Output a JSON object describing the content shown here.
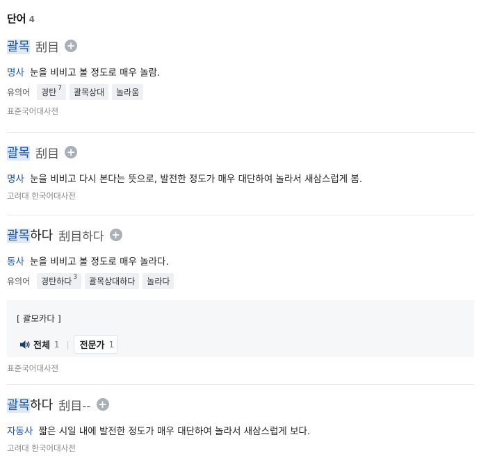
{
  "section": {
    "title": "단어",
    "count": "4"
  },
  "entries": [
    {
      "word_highlight": "괄목",
      "word_rest": "",
      "hanja": "刮目",
      "plus": "+",
      "pos": "명사",
      "definition": "눈을 비비고 볼 정도로 매우 놀람.",
      "synonym_label": "유의어",
      "synonyms": [
        {
          "text": "경탄",
          "sup": "7"
        },
        {
          "text": "괄목상대",
          "sup": ""
        },
        {
          "text": "놀라움",
          "sup": ""
        }
      ],
      "source": "표준국어대사전"
    },
    {
      "word_highlight": "괄목",
      "word_rest": "",
      "hanja": "刮目",
      "plus": "+",
      "pos": "명사",
      "definition": "눈을 비비고 다시 본다는 뜻으로, 발전한 정도가 매우 대단하여 놀라서 새삼스럽게 봄.",
      "source": "고려대 한국어대사전"
    },
    {
      "word_highlight": "괄목",
      "word_rest": "하다",
      "hanja": "刮目하다",
      "plus": "+",
      "pos": "동사",
      "definition": "눈을 비비고 볼 정도로 매우 놀라다.",
      "synonym_label": "유의어",
      "synonyms": [
        {
          "text": "경탄하다",
          "sup": "3"
        },
        {
          "text": "괄목상대하다",
          "sup": ""
        },
        {
          "text": "놀라다",
          "sup": ""
        }
      ],
      "pronunciation": "[ 괄모카다 ]",
      "audio_tabs": [
        {
          "label": "전체",
          "count": "1",
          "icon": "speaker-icon"
        },
        {
          "label": "전문가",
          "count": "1"
        }
      ],
      "source": "표준국어대사전"
    },
    {
      "word_highlight": "괄목",
      "word_rest": "하다",
      "hanja": "刮目--",
      "plus": "+",
      "pos": "자동사",
      "definition": "짧은 시일 내에 발전한 정도가 매우 대단하여 놀라서 새삼스럽게 보다.",
      "source": "고려대 한국어대사전"
    }
  ]
}
